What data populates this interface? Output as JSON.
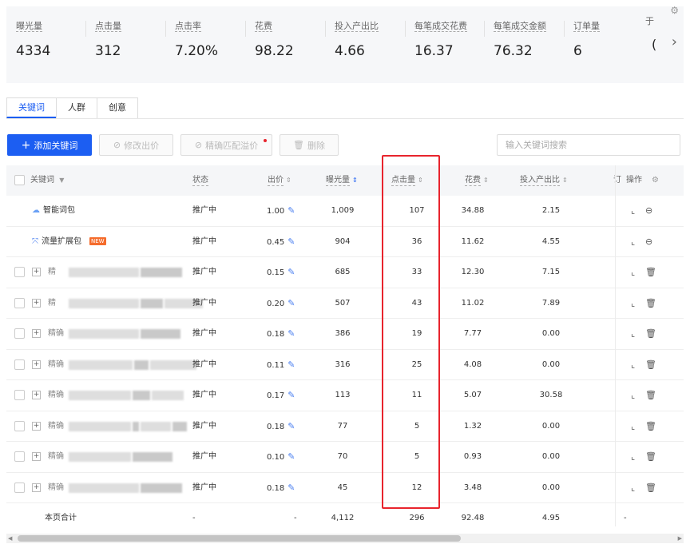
{
  "metrics": [
    {
      "label": "曝光量",
      "value": "4334"
    },
    {
      "label": "点击量",
      "value": "312"
    },
    {
      "label": "点击率",
      "value": "7.20%"
    },
    {
      "label": "花费",
      "value": "98.22"
    },
    {
      "label": "投入产出比",
      "value": "4.66"
    },
    {
      "label": "每笔成交花费",
      "value": "16.37"
    },
    {
      "label": "每笔成交金额",
      "value": "76.32"
    },
    {
      "label": "订单量",
      "value": "6"
    }
  ],
  "metrics_partial": {
    "label": "于",
    "value": "("
  },
  "tabs": [
    "关键词",
    "人群",
    "创意"
  ],
  "toolbar": {
    "add": "添加关键词",
    "modify_bid": "修改出价",
    "premium": "精确匹配溢价",
    "delete": "删除",
    "search_placeholder": "输入关键词搜索"
  },
  "columns": {
    "keyword": "关键词",
    "status": "状态",
    "bid": "出价",
    "impressions": "曝光量",
    "clicks": "点击量",
    "cost": "花费",
    "roi": "投入产出比",
    "orders_partial": "订",
    "ops": "操作"
  },
  "rows": [
    {
      "keyword": "智能词包",
      "status": "推广中",
      "bid": "1.00",
      "impressions": "1,009",
      "clicks": "107",
      "cost": "34.88",
      "roi": "2.15"
    },
    {
      "keyword": "流量扩展包",
      "badge": "NEW",
      "status": "推广中",
      "bid": "0.45",
      "impressions": "904",
      "clicks": "36",
      "cost": "11.62",
      "roi": "4.55"
    },
    {
      "keyword": "精",
      "status": "推广中",
      "bid": "0.15",
      "impressions": "685",
      "clicks": "33",
      "cost": "12.30",
      "roi": "7.15"
    },
    {
      "keyword": "精",
      "status": "推广中",
      "bid": "0.20",
      "impressions": "507",
      "clicks": "43",
      "cost": "11.02",
      "roi": "7.89"
    },
    {
      "keyword": "精确",
      "status": "推广中",
      "bid": "0.18",
      "impressions": "386",
      "clicks": "19",
      "cost": "7.77",
      "roi": "0.00"
    },
    {
      "keyword": "精确",
      "status": "推广中",
      "bid": "0.11",
      "impressions": "316",
      "clicks": "25",
      "cost": "4.08",
      "roi": "0.00"
    },
    {
      "keyword": "精确",
      "status": "推广中",
      "bid": "0.17",
      "impressions": "113",
      "clicks": "11",
      "cost": "5.07",
      "roi": "30.58"
    },
    {
      "keyword": "精确",
      "status": "推广中",
      "bid": "0.18",
      "impressions": "77",
      "clicks": "5",
      "cost": "1.32",
      "roi": "0.00"
    },
    {
      "keyword": "精确",
      "status": "推广中",
      "bid": "0.10",
      "impressions": "70",
      "clicks": "5",
      "cost": "0.93",
      "roi": "0.00"
    },
    {
      "keyword": "精确",
      "status": "推广中",
      "bid": "0.18",
      "impressions": "45",
      "clicks": "12",
      "cost": "3.48",
      "roi": "0.00"
    }
  ],
  "total": {
    "label": "本页合计",
    "status": "-",
    "bid": "-",
    "impressions": "4,112",
    "clicks": "296",
    "cost": "92.48",
    "roi": "4.95",
    "orders": "-"
  },
  "colors": {
    "accent": "#1c5ef2",
    "highlight": "#e8242d"
  }
}
